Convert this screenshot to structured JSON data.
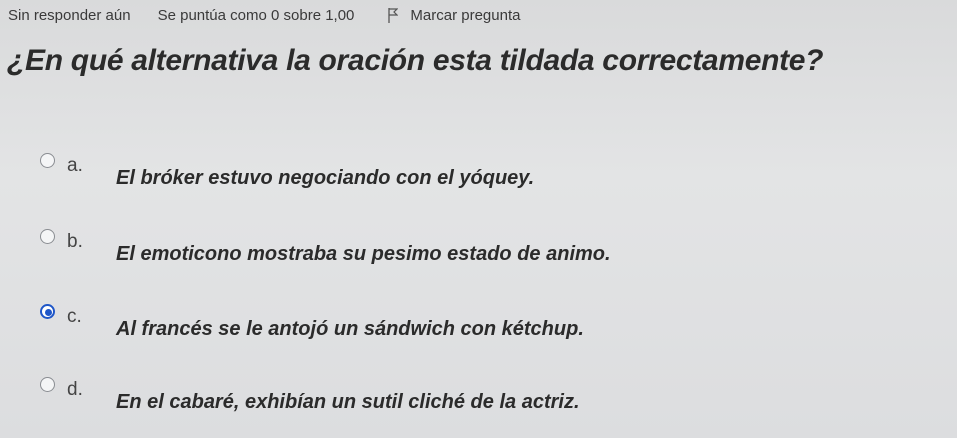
{
  "info": {
    "status": "Sin responder aún",
    "grade": "Se puntúa como 0 sobre 1,00",
    "flag_label": "Marcar pregunta",
    "flag_icon": "flag-icon"
  },
  "question": {
    "text": "¿En qué alternativa la oración esta tildada correctamente?"
  },
  "options": [
    {
      "letter": "a.",
      "text": "El bróker estuvo negociando con el yóquey.",
      "selected": false
    },
    {
      "letter": "b.",
      "text": "El emoticono mostraba su pesimo estado de animo.",
      "selected": false
    },
    {
      "letter": "c.",
      "text": "Al francés se le antojó un sándwich con kétchup.",
      "selected": true
    },
    {
      "letter": "d.",
      "text": "En el cabaré, exhibían un sutil cliché de la actriz.",
      "selected": false
    }
  ],
  "colors": {
    "accent": "#1f56c8",
    "text": "#2b2b2b"
  }
}
